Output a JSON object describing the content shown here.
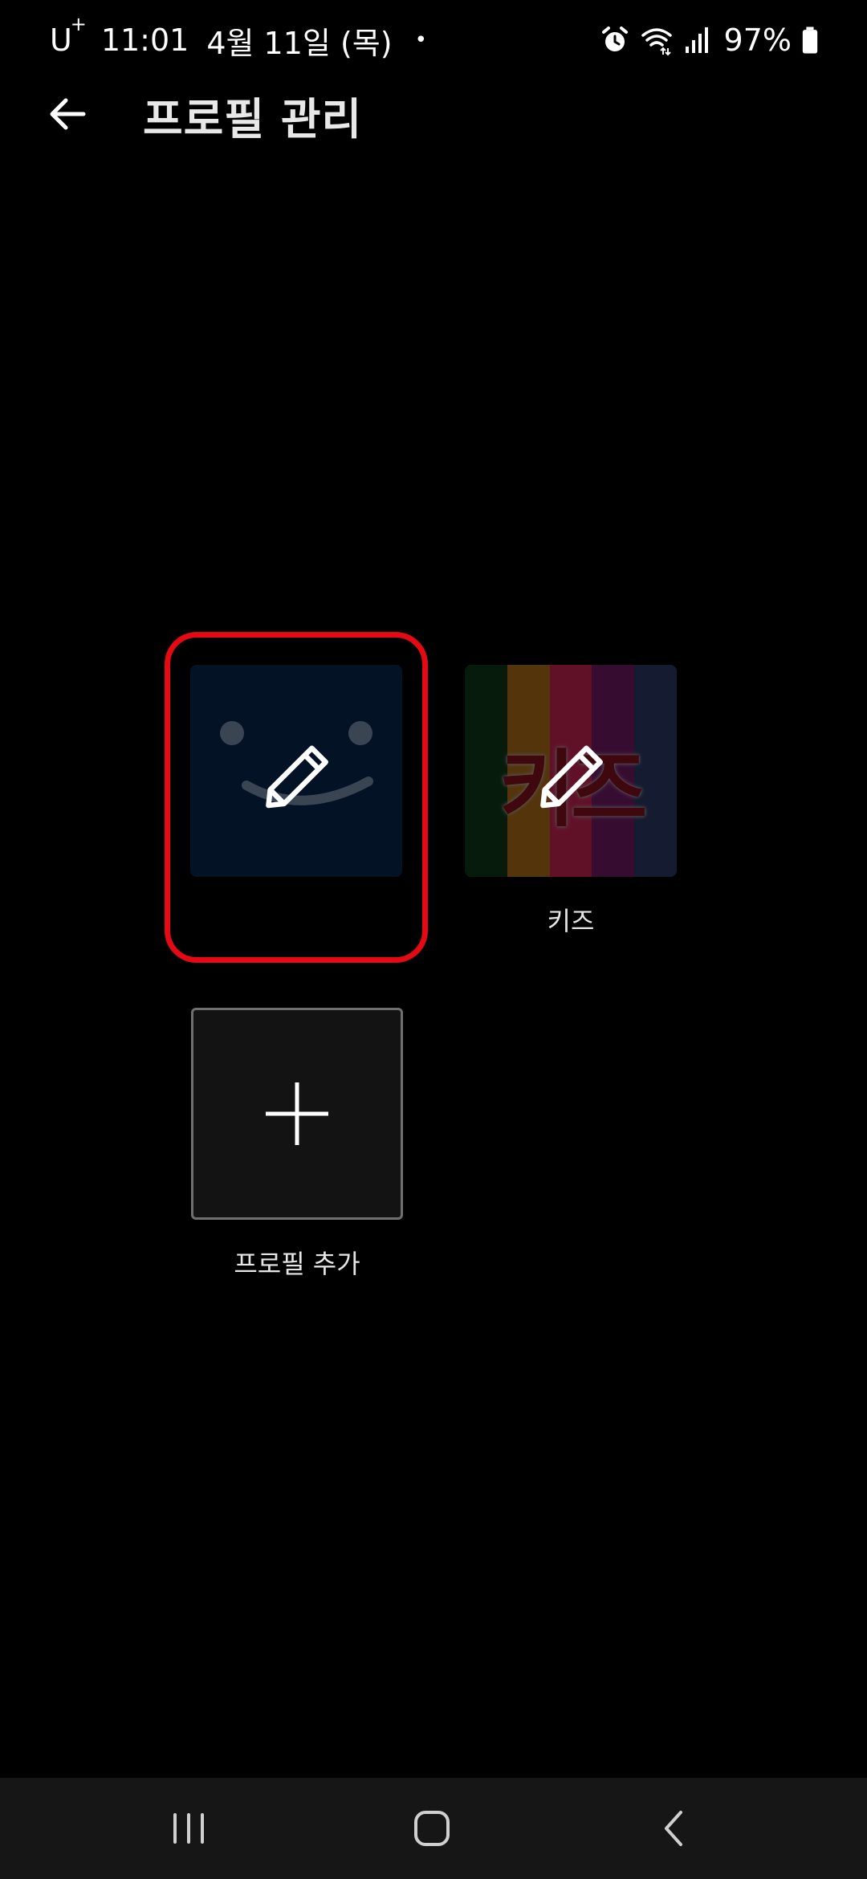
{
  "status_bar": {
    "carrier": "U",
    "carrier_sup": "+",
    "time": "11:01",
    "date": "4월 11일 (목)",
    "dot": "•",
    "battery": "97%",
    "icons": [
      "alarm-icon",
      "wifi-icon",
      "signal-icon",
      "battery-icon"
    ]
  },
  "header": {
    "title": "프로필 관리",
    "back_icon": "arrow-left-icon"
  },
  "profiles": [
    {
      "name": "",
      "icon": "pencil-icon",
      "selected": true,
      "avatar": "smiley"
    },
    {
      "name": "키즈",
      "icon": "pencil-icon",
      "selected": false,
      "avatar": "kids",
      "avatar_text": "키즈"
    }
  ],
  "add_profile": {
    "label": "프로필 추가",
    "icon": "plus-icon"
  },
  "nav": {
    "items": [
      "recent-apps-icon",
      "home-icon",
      "back-icon"
    ]
  },
  "colors": {
    "background": "#000000",
    "highlight": "#e50914",
    "nav_background": "#161616",
    "main_avatar": "#071c3b",
    "kids_stripes": [
      "#0f3d1b",
      "#b8731a",
      "#d6265a",
      "#7a1b6e",
      "#2f3c6a"
    ]
  }
}
